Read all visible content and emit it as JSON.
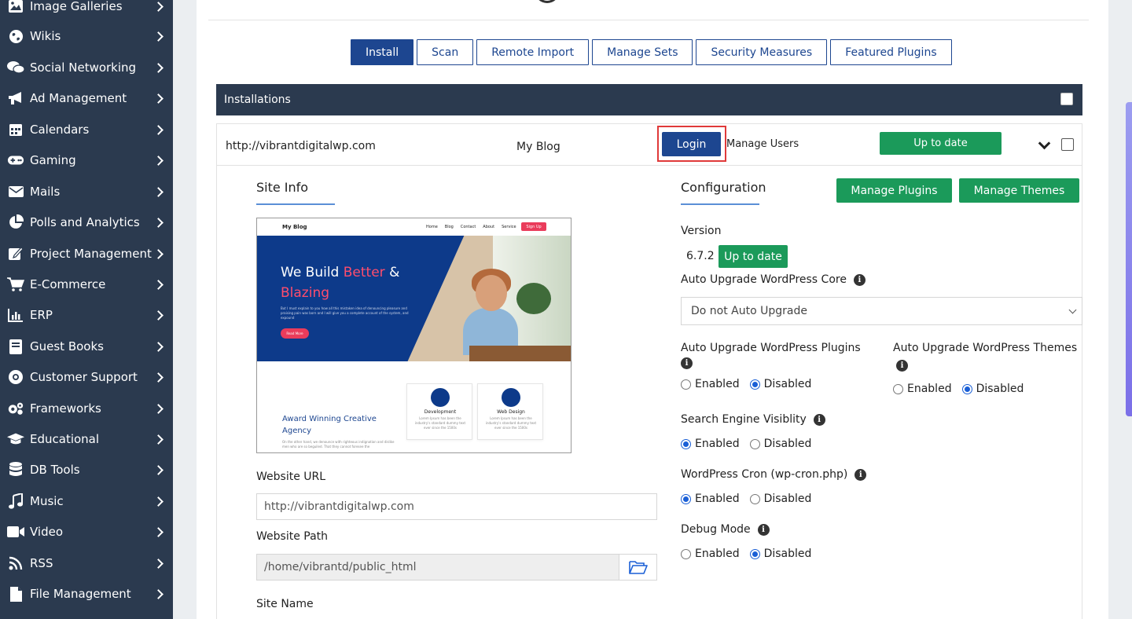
{
  "sidebar": {
    "items": [
      {
        "label": "Image Galleries",
        "icon": "image-icon"
      },
      {
        "label": "Wikis",
        "icon": "globe-icon"
      },
      {
        "label": "Social Networking",
        "icon": "chat-icon"
      },
      {
        "label": "Ad Management",
        "icon": "megaphone-icon"
      },
      {
        "label": "Calendars",
        "icon": "calendar-icon"
      },
      {
        "label": "Gaming",
        "icon": "gamepad-icon"
      },
      {
        "label": "Mails",
        "icon": "mail-icon"
      },
      {
        "label": "Polls and Analytics",
        "icon": "pie-chart-icon"
      },
      {
        "label": "Project Management",
        "icon": "edit-icon"
      },
      {
        "label": "E-Commerce",
        "icon": "cart-icon"
      },
      {
        "label": "ERP",
        "icon": "bar-chart-icon"
      },
      {
        "label": "Guest Books",
        "icon": "book-icon"
      },
      {
        "label": "Customer Support",
        "icon": "lifebuoy-icon"
      },
      {
        "label": "Frameworks",
        "icon": "cogs-icon"
      },
      {
        "label": "Educational",
        "icon": "graduation-cap-icon"
      },
      {
        "label": "DB Tools",
        "icon": "database-icon"
      },
      {
        "label": "Music",
        "icon": "music-icon"
      },
      {
        "label": "Video",
        "icon": "video-icon"
      },
      {
        "label": "RSS",
        "icon": "rss-icon"
      },
      {
        "label": "File Management",
        "icon": "file-icon"
      }
    ]
  },
  "tabs": [
    "Install",
    "Scan",
    "Remote Import",
    "Manage Sets",
    "Security Measures",
    "Featured Plugins"
  ],
  "installations_header": "Installations",
  "installation": {
    "url": "http://vibrantdigitalwp.com",
    "name": "My Blog",
    "login_label": "Login",
    "manage_users_label": "Manage Users",
    "status": "Up to date"
  },
  "site_info": {
    "title": "Site Info",
    "preview": {
      "logo": "My Blog",
      "nav_links": [
        "Home",
        "Blog",
        "Contact",
        "About",
        "Service"
      ],
      "signup": "Sign Up",
      "headline_1": "We Build ",
      "headline_accent": "Better",
      "headline_2": " & ",
      "headline_3": "Blazing",
      "headline_para": "But I must explain to you how all this mistaken idea of denouncing pleasure and praising pain was born and I will give you a complete account of the system, and expound",
      "cta": "Read More",
      "award_1": "Award Winning Creative",
      "award_2": "Agency",
      "award_para": "On the other hand, we denounce with righteous indignation and dislike men who are so beguiled. That they cannot foresee the",
      "cards": [
        {
          "title": "Development",
          "desc": "Lorem Ipsum has been the industry's standard dummy text ever since the 1500s"
        },
        {
          "title": "Web Design",
          "desc": "Lorem Ipsum has been the industry's standard dummy text ever since the 1500s"
        }
      ]
    },
    "website_url_label": "Website URL",
    "website_url_value": "http://vibrantdigitalwp.com",
    "website_path_label": "Website Path",
    "website_path_value": "/home/vibrantd/public_html",
    "site_name_label": "Site Name"
  },
  "configuration": {
    "title": "Configuration",
    "manage_plugins": "Manage Plugins",
    "manage_themes": "Manage Themes",
    "version_label": "Version",
    "version_value": "6.7.2",
    "version_status": "Up to date",
    "auto_core_label": "Auto Upgrade WordPress Core",
    "auto_core_value": "Do not Auto Upgrade",
    "auto_plugins_label": "Auto Upgrade WordPress Plugins",
    "auto_themes_label": "Auto Upgrade WordPress Themes",
    "search_engine_label": "Search Engine Visiblity",
    "cron_label": "WordPress Cron (wp-cron.php)",
    "debug_label": "Debug Mode",
    "enabled": "Enabled",
    "disabled": "Disabled",
    "selections": {
      "auto_plugins": "Disabled",
      "auto_themes": "Disabled",
      "search_engine": "Enabled",
      "cron": "Enabled",
      "debug": "Disabled"
    }
  },
  "colors": {
    "sidebar_bg": "#2b3a4f",
    "primary_blue": "#1d4690",
    "success_green": "#1b9a5a",
    "highlight_red": "#e03a3a"
  }
}
